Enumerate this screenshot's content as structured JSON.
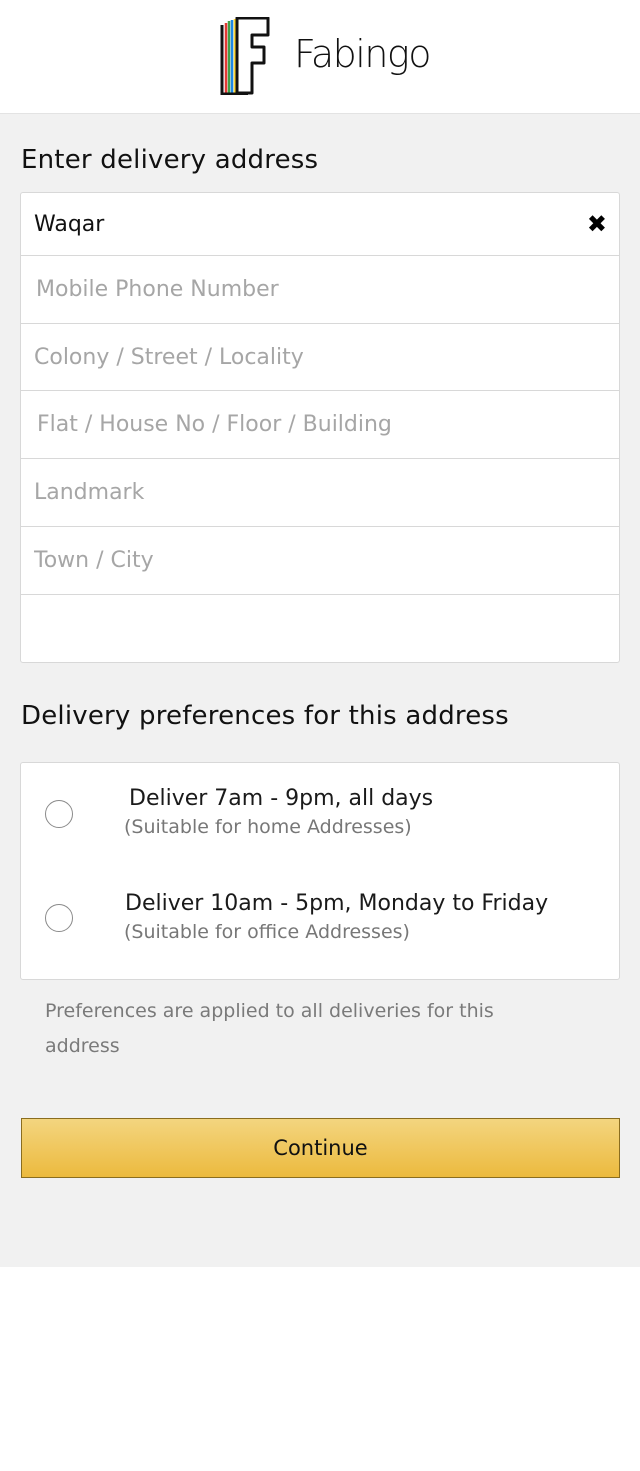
{
  "brand": {
    "name": "Fabingo",
    "logo_letter": "F",
    "logo_stripe_colors": [
      "#e53935",
      "#43a047",
      "#1e88e5",
      "#fdd835"
    ]
  },
  "address": {
    "heading": "Enter delivery address",
    "name_value": "Waqar",
    "phone_placeholder": "Mobile Phone Number",
    "street_placeholder": "Colony / Street / Locality",
    "flat_placeholder": "Flat / House No / Floor / Building",
    "landmark_placeholder": "Landmark",
    "city_placeholder": "Town / City",
    "extra_value": "",
    "clear_icon": "close-icon"
  },
  "preferences": {
    "heading": "Delivery preferences for this address",
    "options": [
      {
        "title": "Deliver 7am - 9pm, all days",
        "subtitle": "(Suitable for home Addresses)",
        "selected": false
      },
      {
        "title": "Deliver 10am - 5pm, Monday to Friday",
        "subtitle": "(Suitable for office Addresses)",
        "selected": false
      }
    ],
    "note": "Preferences are applied to all deliveries for this address"
  },
  "actions": {
    "continue_label": "Continue",
    "button_color": "#ecba3e"
  }
}
